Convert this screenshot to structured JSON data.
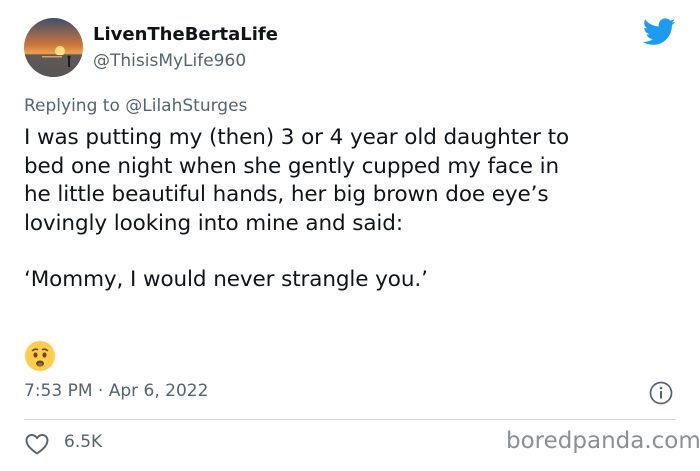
{
  "user": {
    "display_name": "LivenTheBertaLife",
    "handle": "@ThisisMyLife960",
    "avatar_icon": "sunset-avatar"
  },
  "reply": {
    "prefix": "Replying to",
    "mention": "@LilahSturges"
  },
  "tweet": {
    "lines": [
      "I was putting my (then) 3 or 4 year old daughter to",
      "bed one night when she gently cupped my face in",
      "he little beautiful hands, her big brown doe eye’s",
      "lovingly looking into mine and said:"
    ],
    "quote": "‘Mommy, I would never strangle you.’",
    "emoji": "worried-face-emoji"
  },
  "meta": {
    "timestamp": "7:53 PM · Apr 6, 2022",
    "likes": "6.5K"
  },
  "watermark": "boredpanda.com",
  "colors": {
    "twitter_blue": "#1d9bf0",
    "secondary_text": "#536471",
    "primary_text": "#0f1419",
    "divider": "#cfd9de",
    "emoji_yellow": "#ffcc4d"
  }
}
